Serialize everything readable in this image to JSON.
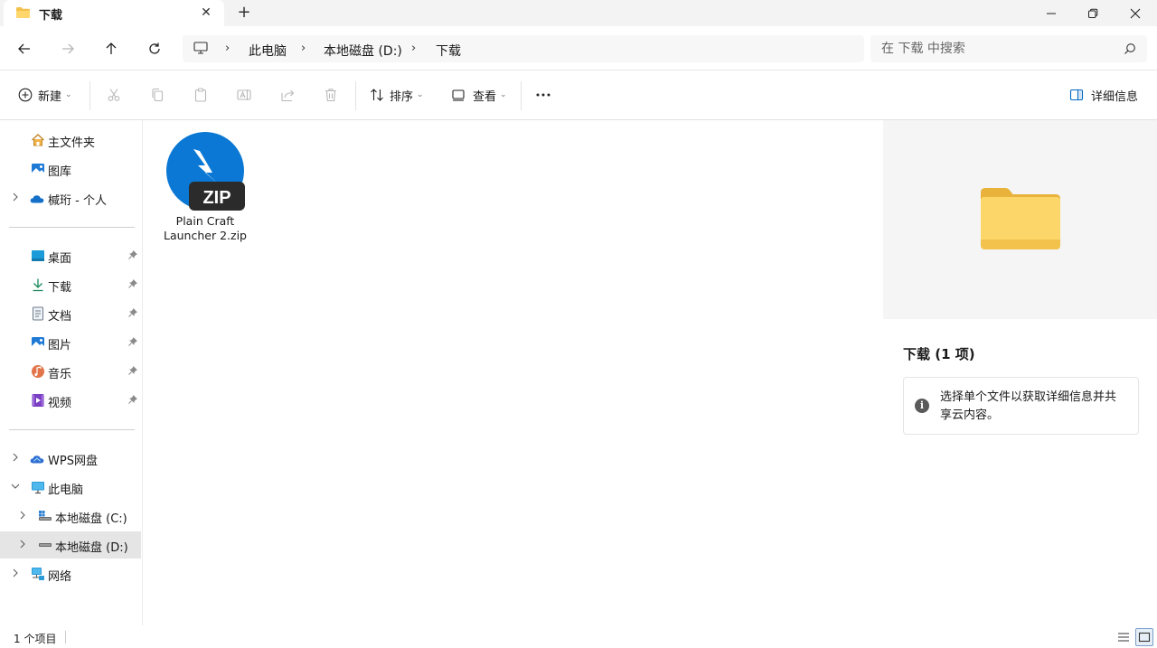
{
  "window": {
    "tab_title": "下载",
    "tab_close": "✕",
    "new_tab": "+"
  },
  "address": {
    "crumbs": [
      "此电脑",
      "本地磁盘 (D:)",
      "下载"
    ],
    "separator": "›"
  },
  "search": {
    "placeholder": "在 下载 中搜索"
  },
  "toolbar": {
    "new_label": "新建",
    "sort_label": "排序",
    "view_label": "查看",
    "more_label": "···",
    "details_label": "详细信息"
  },
  "sidebar": {
    "quick": [
      {
        "label": "主文件夹",
        "icon": "home-icon"
      },
      {
        "label": "图库",
        "icon": "gallery-icon"
      },
      {
        "label": "椷珩 - 个人",
        "icon": "onedrive-icon"
      }
    ],
    "pinned": [
      {
        "label": "桌面",
        "icon": "desktop-icon"
      },
      {
        "label": "下载",
        "icon": "download-icon"
      },
      {
        "label": "文档",
        "icon": "document-icon"
      },
      {
        "label": "图片",
        "icon": "pictures-icon"
      },
      {
        "label": "音乐",
        "icon": "music-icon"
      },
      {
        "label": "视频",
        "icon": "video-icon"
      }
    ],
    "drives": [
      {
        "label": "WPS网盘",
        "icon": "wps-cloud-icon"
      },
      {
        "label": "此电脑",
        "icon": "this-pc-icon"
      },
      {
        "label": "本地磁盘 (C:)",
        "icon": "drive-c-icon"
      },
      {
        "label": "本地磁盘 (D:)",
        "icon": "drive-d-icon",
        "selected": true
      },
      {
        "label": "网络",
        "icon": "network-icon"
      }
    ]
  },
  "files": [
    {
      "name": "Plain Craft Launcher 2.zip",
      "name_line1": "Plain Craft",
      "name_line2": "Launcher 2.zip",
      "badge": "ZIP",
      "icon": "zip-archive-icon"
    }
  ],
  "details": {
    "title": "下载 (1 项)",
    "info_icon_text": "i",
    "info_text": "选择单个文件以获取详细信息并共享云内容。"
  },
  "status": {
    "count": "1 个项目"
  },
  "colors": {
    "accent": "#0067c0",
    "folder_yellow": "#f7c948",
    "zip_blue": "#0a78d4",
    "zip_badge": "#2b2b2b"
  }
}
